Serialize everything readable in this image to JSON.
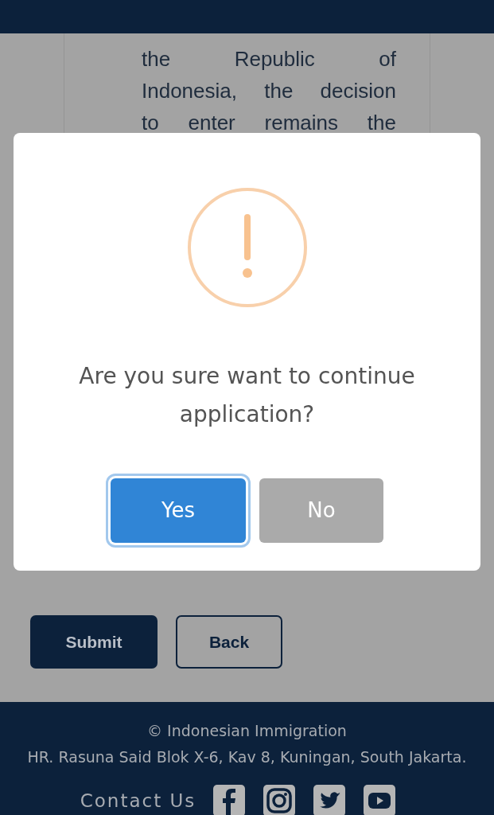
{
  "notice_lines": [
    "the Republic of",
    "Indonesia, the decision",
    "to enter remains the"
  ],
  "dialog": {
    "message": "Are you sure want to continue application?",
    "buttons": [
      {
        "label": "Yes",
        "kind": "confirm",
        "focused": true
      },
      {
        "label": "No",
        "kind": "cancel",
        "focused": false
      }
    ]
  },
  "form_buttons": [
    {
      "label": "Submit",
      "kind": "primary"
    },
    {
      "label": "Back",
      "kind": "outline"
    }
  ],
  "footer": {
    "copyright": "© Indonesian Immigration",
    "address": "HR. Rasuna Said Blok X-6, Kav 8, Kuningan, South Jakarta.",
    "contact_label": "Contact Us"
  }
}
